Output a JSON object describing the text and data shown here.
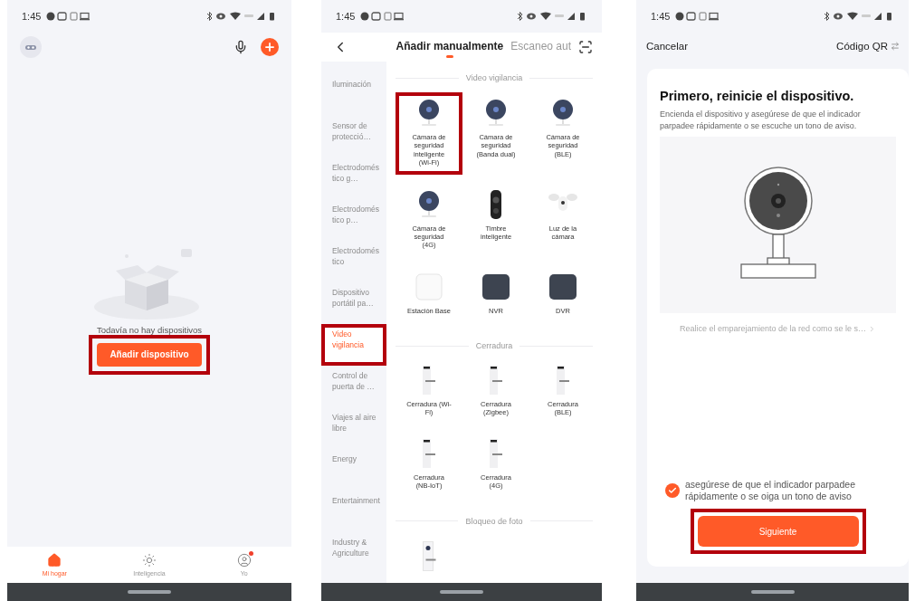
{
  "home_screen": {
    "status_bar": {
      "time": "1:45"
    },
    "empty_text": "Todavía no hay dispositivos",
    "add_button": {
      "label": "Añadir dispositivo",
      "highlighted": true
    },
    "tabs": [
      {
        "label": "Mi hogar",
        "kind": "home",
        "selected": true,
        "badge": false
      },
      {
        "label": "Inteligencia",
        "kind": "scene",
        "selected": false,
        "badge": false
      },
      {
        "label": "Yo",
        "kind": "profile",
        "selected": false,
        "badge": true
      }
    ]
  },
  "add_device_screen": {
    "status_bar": {
      "time": "1:45"
    },
    "tabs": [
      {
        "label": "Añadir manualmente",
        "selected": true
      },
      {
        "label": "Escaneo aut",
        "selected": false
      }
    ],
    "categories": [
      {
        "label": "Iluminación",
        "selected": false,
        "highlighted": false
      },
      {
        "label": "Sensor de protecció…",
        "selected": false,
        "highlighted": false
      },
      {
        "label": "Electrodoméstico g…",
        "selected": false,
        "highlighted": false
      },
      {
        "label": "Electrodoméstico p…",
        "selected": false,
        "highlighted": false
      },
      {
        "label": "Electrodoméstico",
        "selected": false,
        "highlighted": false
      },
      {
        "label": "Dispositivo portátil pa…",
        "selected": false,
        "highlighted": false
      },
      {
        "label": "Video vigilancia",
        "selected": true,
        "highlighted": true
      },
      {
        "label": "Control de puerta de …",
        "selected": false,
        "highlighted": false
      },
      {
        "label": "Viajes al aire libre",
        "selected": false,
        "highlighted": false
      },
      {
        "label": "Energy",
        "selected": false,
        "highlighted": false
      },
      {
        "label": "Entertainment",
        "selected": false,
        "highlighted": false
      },
      {
        "label": "Industry & Agriculture",
        "selected": false,
        "highlighted": false
      }
    ],
    "sections": [
      {
        "title": "Video vigilancia",
        "devices": [
          {
            "label": "Cámara de seguridad inteligente (Wi-Fi)",
            "kind": "camera",
            "highlighted": true
          },
          {
            "label": "Cámara de seguridad (Banda dual)",
            "kind": "camera",
            "highlighted": false
          },
          {
            "label": "Cámara de seguridad (BLE)",
            "kind": "camera",
            "highlighted": false
          },
          {
            "label": "Cámara de seguridad (4G)",
            "kind": "camera",
            "highlighted": false
          },
          {
            "label": "Timbre inteligente",
            "kind": "doorbell",
            "highlighted": false
          },
          {
            "label": "Luz de la cámara",
            "kind": "floodlight",
            "highlighted": false
          },
          {
            "label": "Estación Base",
            "kind": "hub",
            "highlighted": false
          },
          {
            "label": "NVR",
            "kind": "recorder",
            "highlighted": false
          },
          {
            "label": "DVR",
            "kind": "recorder",
            "highlighted": false
          }
        ]
      },
      {
        "title": "Cerradura",
        "devices": [
          {
            "label": "Cerradura (Wi-Fi)",
            "kind": "lock",
            "highlighted": false
          },
          {
            "label": "Cerradura (Zigbee)",
            "kind": "lock",
            "highlighted": false
          },
          {
            "label": "Cerradura (BLE)",
            "kind": "lock",
            "highlighted": false
          },
          {
            "label": "Cerradura (NB-IoT)",
            "kind": "lock",
            "highlighted": false
          },
          {
            "label": "Cerradura (4G)",
            "kind": "lock",
            "highlighted": false
          }
        ]
      },
      {
        "title": "Bloqueo de foto",
        "devices": [
          {
            "kind": "photo_lock",
            "highlighted": false
          }
        ]
      }
    ]
  },
  "reset_screen": {
    "status_bar": {
      "time": "1:45"
    },
    "cancel": "Cancelar",
    "qr_link": "Código QR",
    "title": "Primero, reinicie el dispositivo.",
    "description": "Encienda el dispositivo y asegúrese de que el indicador parpadee rápidamente o se escuche un tono de aviso.",
    "help_link": "Realice el emparejamiento de la red como se le s…",
    "confirm": {
      "label": "asegúrese de que el indicador parpadee rápidamente o se oiga un tono de aviso",
      "checked": true
    },
    "next_button": {
      "label": "Siguiente",
      "highlighted": true
    }
  }
}
